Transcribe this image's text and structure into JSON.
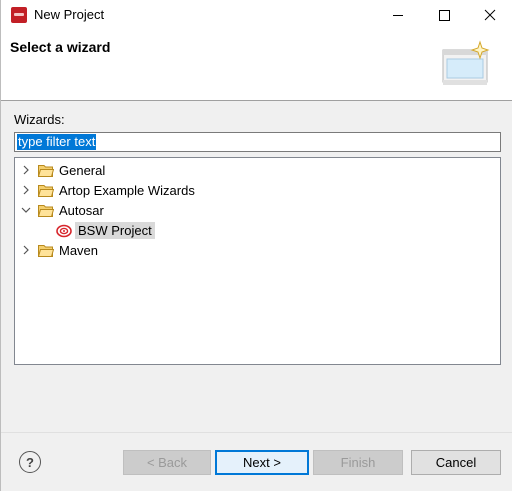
{
  "window": {
    "title": "New Project"
  },
  "header": {
    "title": "Select a wizard"
  },
  "filter": {
    "label": "Wizards:",
    "value": "type filter text"
  },
  "tree": {
    "items": [
      {
        "label": "General",
        "expanded": false,
        "icon": "folder-icon"
      },
      {
        "label": "Artop Example Wizards",
        "expanded": false,
        "icon": "folder-icon"
      },
      {
        "label": "Autosar",
        "expanded": true,
        "icon": "folder-open-icon"
      },
      {
        "label": "BSW Project",
        "child": true,
        "selected": true,
        "icon": "bsw-project-icon"
      },
      {
        "label": "Maven",
        "expanded": false,
        "icon": "folder-icon"
      }
    ]
  },
  "buttons": {
    "help": "?",
    "back": "< Back",
    "next": "Next >",
    "finish": "Finish",
    "cancel": "Cancel"
  },
  "colors": {
    "selection": "#0078d7",
    "folder": "#e8b64a",
    "app_icon": "#c21f26"
  }
}
